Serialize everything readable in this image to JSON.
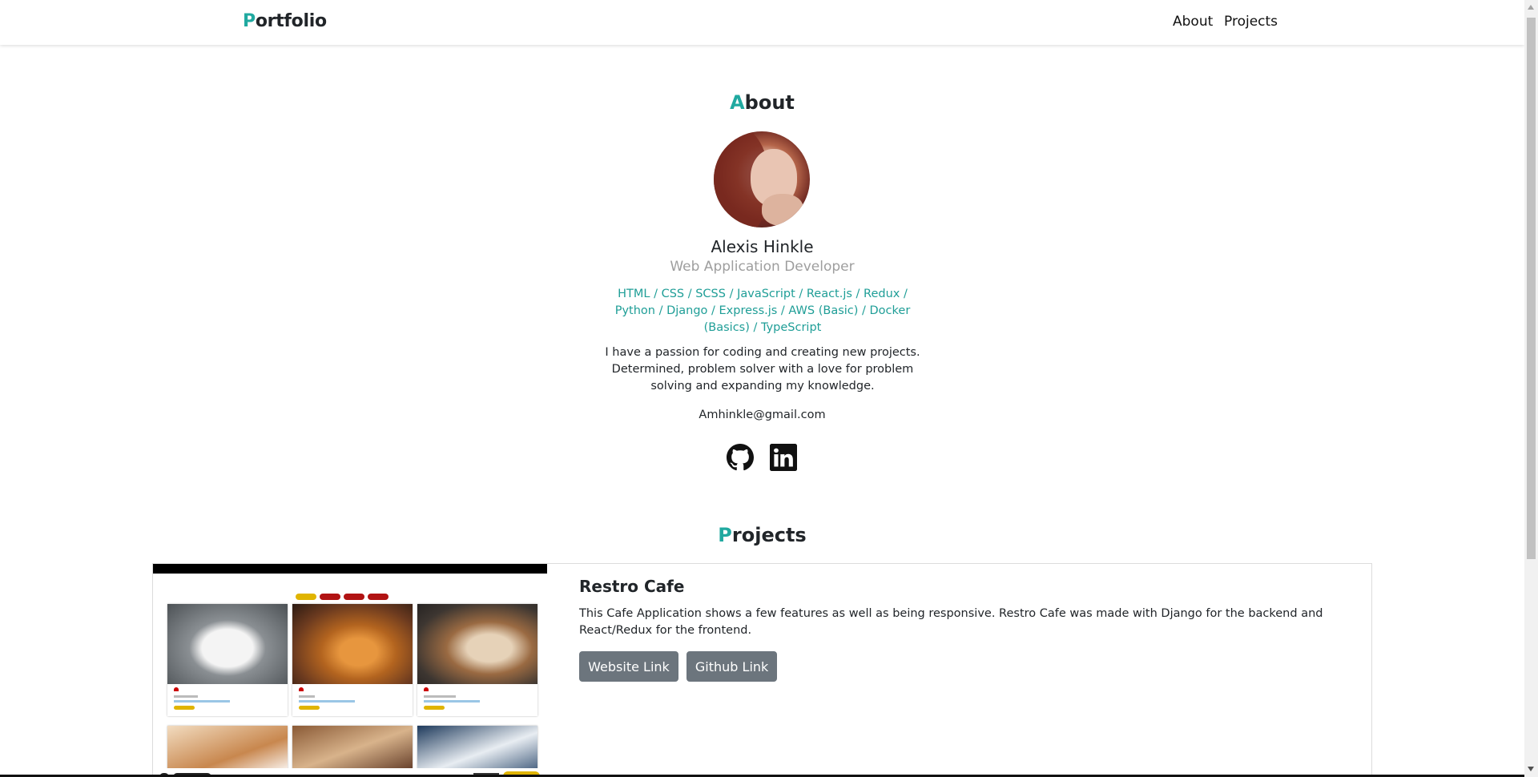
{
  "nav": {
    "brand_initial": "P",
    "brand_rest": "ortfolio",
    "links": [
      {
        "label": "About"
      },
      {
        "label": "Projects"
      }
    ]
  },
  "about": {
    "title_initial": "A",
    "title_rest": "bout",
    "name": "Alexis Hinkle",
    "role": "Web Application Developer",
    "skills": "HTML / CSS / SCSS / JavaScript / React.js / Redux / Python / Django / Express.js / AWS (Basic) / Docker (Basics) / TypeScript",
    "bio": "I have a passion for coding and creating new projects. Determined, problem solver with a love for problem solving and expanding my knowledge.",
    "email": "Amhinkle@gmail.com",
    "social": [
      {
        "icon": "github-icon"
      },
      {
        "icon": "linkedin-icon"
      }
    ]
  },
  "projects": {
    "title_initial": "P",
    "title_rest": "rojects",
    "items": [
      {
        "name": "Restro Cafe",
        "description": "This Cafe Application shows a few features as well as being responsive. Restro Cafe was made with Django for the backend and React/Redux for the frontend.",
        "website_label": "Website Link",
        "github_label": "Github Link"
      }
    ]
  },
  "colors": {
    "accent": "#20a9a0",
    "skills_text": "#1f9e97",
    "role_text": "#9e9e9e",
    "button_bg": "#6c757d"
  }
}
